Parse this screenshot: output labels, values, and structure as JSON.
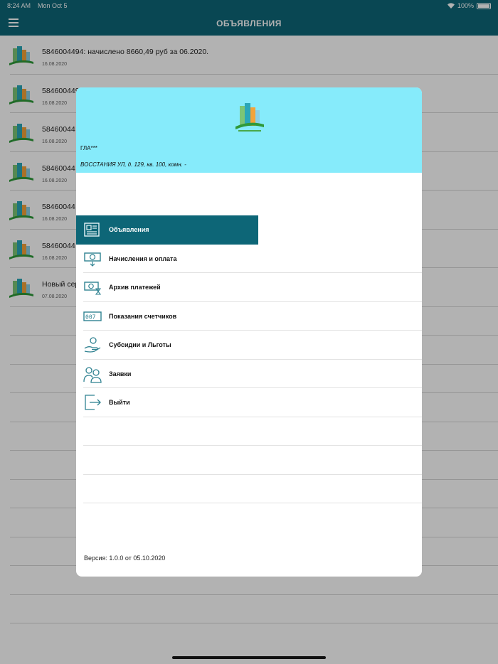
{
  "status": {
    "time": "8:24 AM",
    "date": "Mon Oct 5",
    "battery": "100%"
  },
  "header": {
    "title": "ОБЪЯВЛЕНИЯ"
  },
  "list": [
    {
      "text": "5846004494: начислено 8660,49 руб за 06.2020.",
      "date": "16.08.2020"
    },
    {
      "text": "584600449",
      "date": "16.08.2020"
    },
    {
      "text": "58460044",
      "date": "16.08.2020"
    },
    {
      "text": "58460044",
      "date": "16.08.2020"
    },
    {
      "text": "58460044",
      "date": "16.08.2020"
    },
    {
      "text": "58460044",
      "date": "16.08.2020"
    },
    {
      "text": "Новый сер",
      "date": "07.08.2020"
    }
  ],
  "drawer": {
    "user": "ГЛА***",
    "address": "ВОССТАНИЯ УЛ, д. 129, кв. 100, комн. -",
    "items": [
      {
        "label": "Объявления",
        "icon": "newspaper-icon"
      },
      {
        "label": "Начисления и оплата",
        "icon": "money-icon"
      },
      {
        "label": "Архив платежей",
        "icon": "archive-payments-icon"
      },
      {
        "label": "Показания счетчиков",
        "icon": "meter-icon"
      },
      {
        "label": "Субсидии и Льготы",
        "icon": "subsidy-icon"
      },
      {
        "label": "Заявки",
        "icon": "requests-icon"
      },
      {
        "label": "Выйти",
        "icon": "logout-icon"
      }
    ],
    "version": "Версия: 1.0.0 от 05.10.2020"
  },
  "colors": {
    "accent": "#0d6677",
    "drawer_header": "#86ebfb",
    "icon": "#2f8291"
  }
}
